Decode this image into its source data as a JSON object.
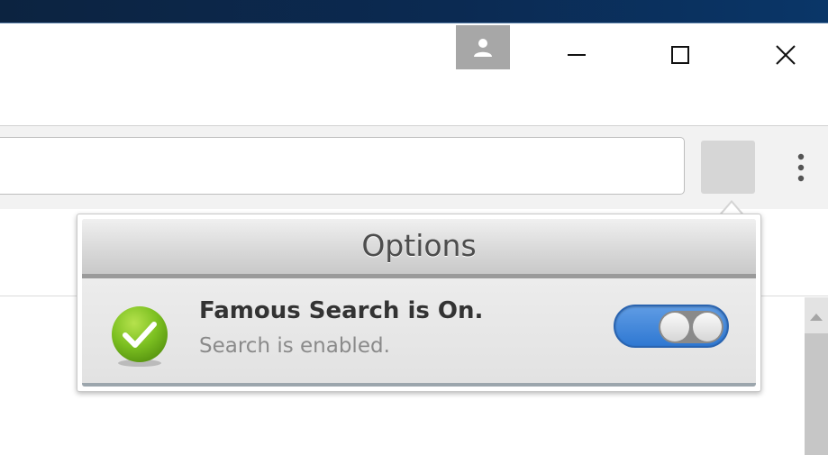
{
  "browser": {
    "profile_icon": "person-icon",
    "window_controls": {
      "minimize_icon": "minimize-icon",
      "maximize_icon": "maximize-icon",
      "close_icon": "close-icon"
    },
    "menu_icon": "kebab-menu-icon",
    "address_bar": {
      "value": ""
    }
  },
  "popup": {
    "title": "Options",
    "status": {
      "icon": "check-circle-icon",
      "title": "Famous Search is On.",
      "subtitle": "Search is enabled."
    },
    "toggle": {
      "state": "on"
    }
  },
  "colors": {
    "title_band": "#0b2a52",
    "toggle_on": "#3a82d8",
    "check_green": "#7cc021",
    "profile_button": "#a7a7a7",
    "extension_button": "#d6d6d6"
  }
}
